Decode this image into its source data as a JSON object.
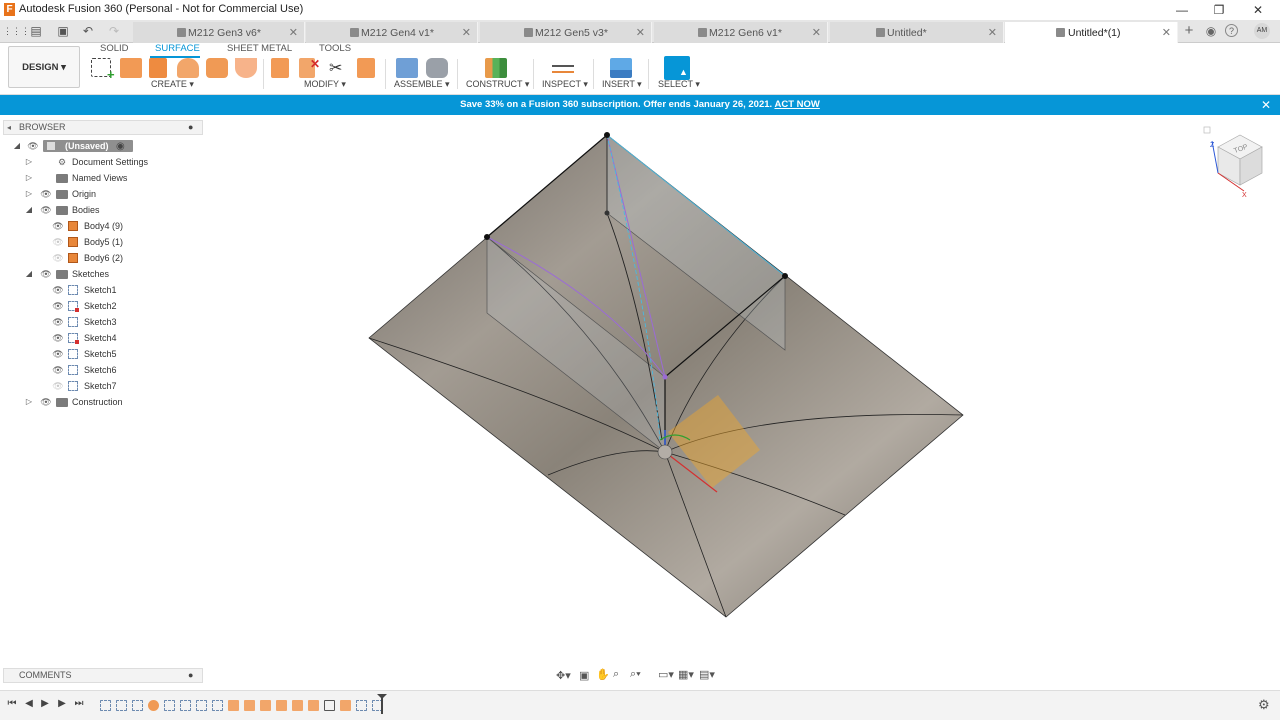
{
  "app": {
    "logo_letter": "F",
    "title": "Autodesk Fusion 360 (Personal - Not for Commercial Use)"
  },
  "window_controls": {
    "minimize": "—",
    "restore": "❐",
    "close": "✕"
  },
  "quick_access": {
    "grid": "⋮⋮⋮",
    "file": "▤",
    "save": "▣",
    "undo": "↶",
    "redo": "↷"
  },
  "tabs": [
    {
      "label": "M212 Gen3 v6*"
    },
    {
      "label": "M212 Gen4 v1*"
    },
    {
      "label": "M212 Gen5 v3*"
    },
    {
      "label": "M212 Gen6 v1*"
    },
    {
      "label": "Untitled*"
    },
    {
      "label": "Untitled*(1)"
    }
  ],
  "tab_close": "✕",
  "tab_right": {
    "add": "+",
    "jobs": "◉",
    "help": "?",
    "user_initials": "AM"
  },
  "toolbar": {
    "workspace": "DESIGN ▾",
    "subtabs": [
      "SOLID",
      "SURFACE",
      "SHEET METAL",
      "TOOLS"
    ],
    "groups": [
      "CREATE ▾",
      "MODIFY ▾",
      "ASSEMBLE ▾",
      "CONSTRUCT ▾",
      "INSPECT ▾",
      "INSERT ▾",
      "SELECT ▾"
    ]
  },
  "promo": {
    "text": "Save 33% on a Fusion 360 subscription. Offer ends January 26, 2021.",
    "link": "ACT NOW",
    "close": "✕"
  },
  "browser": {
    "title": "BROWSER",
    "root": "(Unsaved)",
    "items": [
      {
        "label": "Document Settings"
      },
      {
        "label": "Named Views"
      },
      {
        "label": "Origin"
      },
      {
        "label": "Bodies"
      },
      {
        "label": "Body4 (9)"
      },
      {
        "label": "Body5 (1)"
      },
      {
        "label": "Body6 (2)"
      },
      {
        "label": "Sketches"
      },
      {
        "label": "Sketch1"
      },
      {
        "label": "Sketch2"
      },
      {
        "label": "Sketch3"
      },
      {
        "label": "Sketch4"
      },
      {
        "label": "Sketch5"
      },
      {
        "label": "Sketch6"
      },
      {
        "label": "Sketch7"
      },
      {
        "label": "Construction"
      }
    ]
  },
  "comments": {
    "title": "COMMENTS"
  },
  "viewcube": {
    "face_label": "TOP"
  },
  "navbar": {
    "orbit": "✥▾",
    "look": "▣",
    "pan": "✋",
    "zoom": "⌕",
    "fit": "⌕▾",
    "display": "▭▾",
    "grid": "▦▾",
    "viewports": "▤▾"
  },
  "timeline": {
    "first": "⏮",
    "prev": "◀",
    "play": "▶",
    "next": "▶",
    "last": "⏭",
    "settings": "⚙"
  },
  "colors": {
    "accent": "#0696d7",
    "brand_orange": "#e8731a",
    "surface": "#8c857b"
  }
}
